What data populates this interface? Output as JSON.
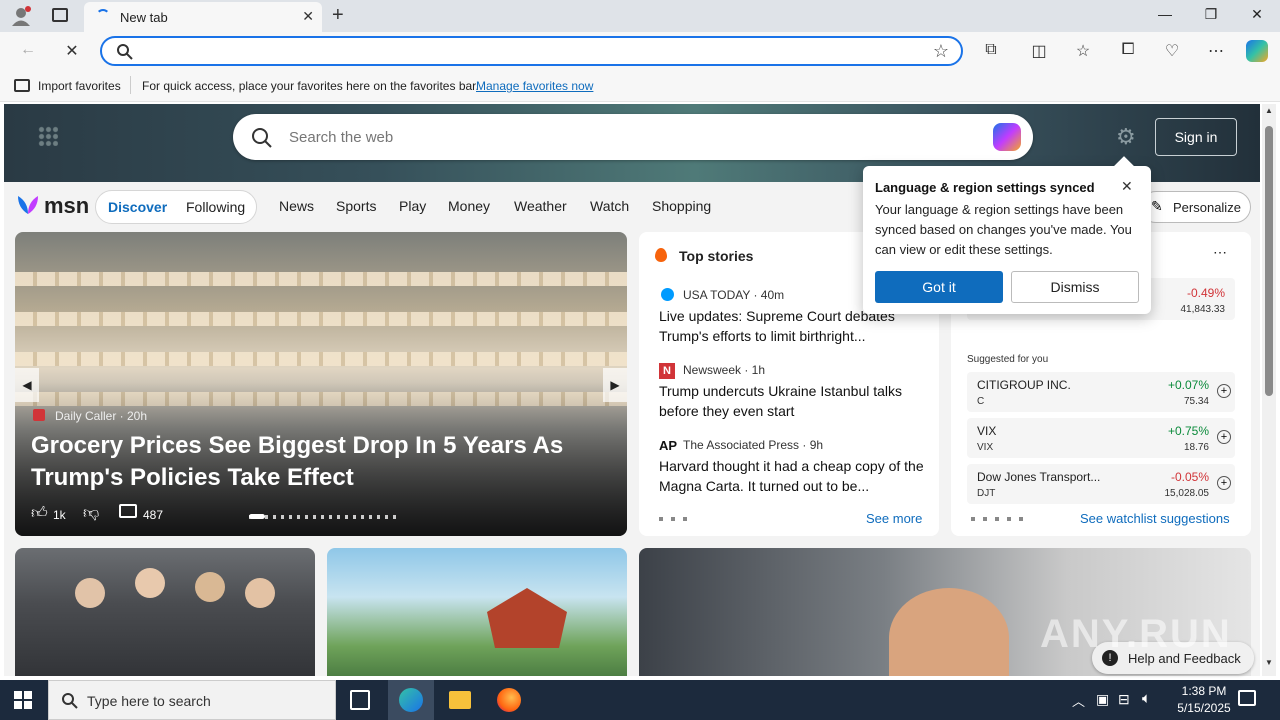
{
  "browser": {
    "tab_title": "New tab",
    "address_value": "",
    "favbar": {
      "import_label": "Import favorites",
      "message": "For quick access, place your favorites here on the favorites bar.",
      "manage_link": "Manage favorites now"
    }
  },
  "msn": {
    "search_placeholder": "Search the web",
    "signin": "Sign in",
    "logo": "msn",
    "tabs": [
      "Discover",
      "Following"
    ],
    "nav": [
      "News",
      "Sports",
      "Play",
      "Money",
      "Weather",
      "Watch",
      "Shopping"
    ],
    "personalize": "Personalize",
    "hero": {
      "source": "Daily Caller · 20h",
      "headline": "Grocery Prices See Biggest Drop In 5 Years As Trump's Policies Take Effect",
      "likes": "1k",
      "comments": "487"
    },
    "top_stories": {
      "title": "Top stories",
      "items": [
        {
          "source": "USA TODAY · 40m",
          "headline": "Live updates: Supreme Court debates Trump's efforts to limit birthright..."
        },
        {
          "source": "Newsweek · 1h",
          "headline": "Trump undercuts Ukraine Istanbul talks before they even start"
        },
        {
          "source": "The Associated Press · 9h",
          "headline": "Harvard thought it had a cheap copy of the Magna Carta. It turned out to be..."
        }
      ],
      "see_more": "See more"
    },
    "watchlist": {
      "top_change": "-0.49%",
      "top_value": "41,843.33",
      "suggested_label": "Suggested for you",
      "items": [
        {
          "name": "CITIGROUP INC.",
          "ticker": "C",
          "change": "+0.07%",
          "value": "75.34",
          "color": "#0a8a3a"
        },
        {
          "name": "VIX",
          "ticker": "VIX",
          "change": "+0.75%",
          "value": "18.76",
          "color": "#0a8a3a"
        },
        {
          "name": "Dow Jones Transport...",
          "ticker": "DJT",
          "change": "-0.05%",
          "value": "15,028.05",
          "color": "#d13438"
        }
      ],
      "see_suggestions": "See watchlist suggestions"
    },
    "popup": {
      "title": "Language & region settings synced",
      "body": "Your language & region settings have been synced based on changes you've made. You can view or edit these settings.",
      "got_it": "Got it",
      "dismiss": "Dismiss"
    },
    "help": "Help and Feedback"
  },
  "taskbar": {
    "search_placeholder": "Type here to search",
    "time": "1:38 PM",
    "date": "5/15/2025"
  },
  "watermark": "ANY.RUN"
}
